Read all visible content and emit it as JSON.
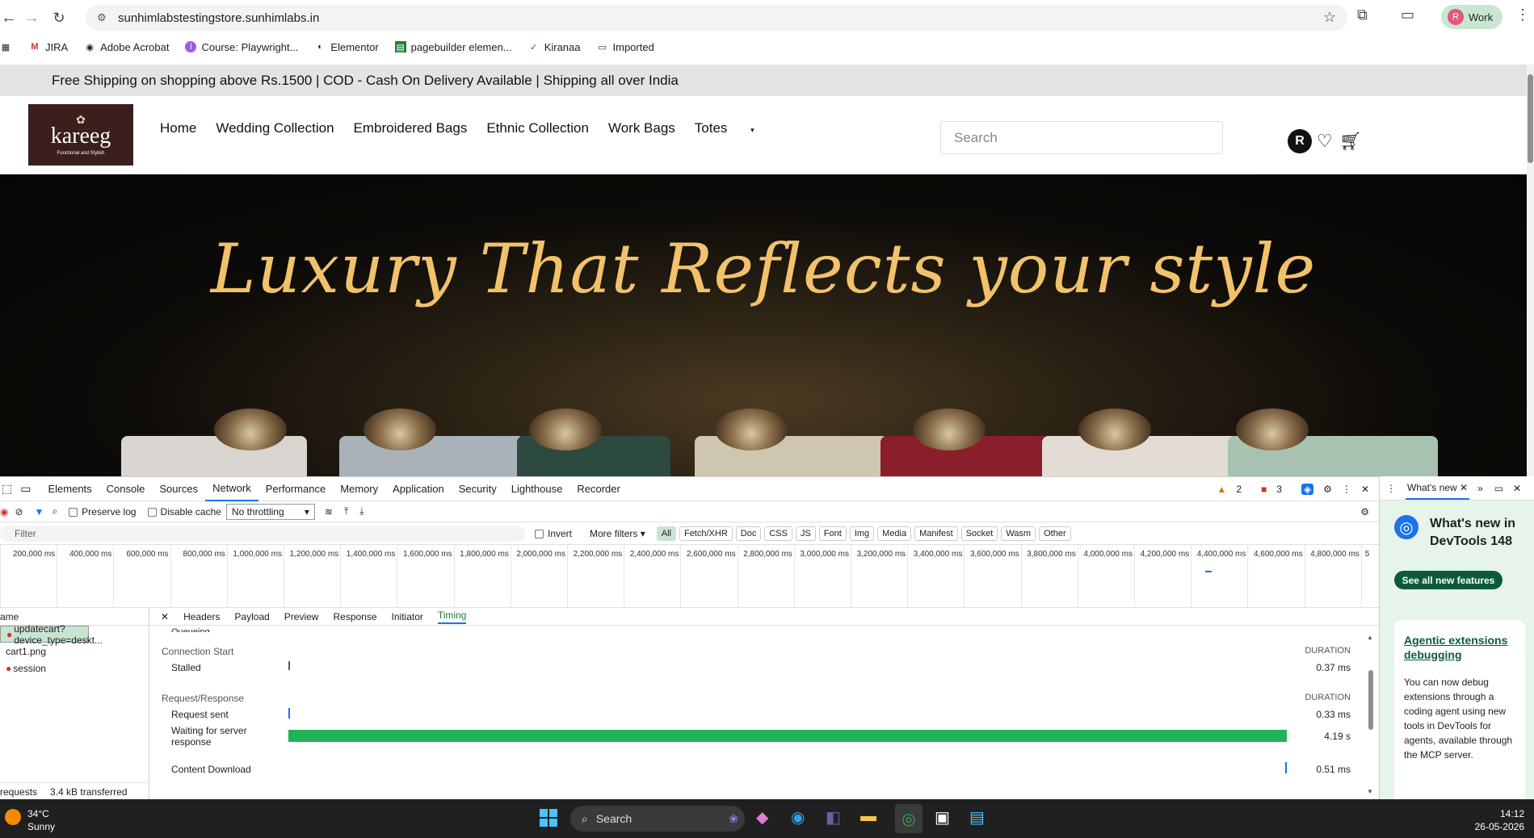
{
  "browser": {
    "url": "sunhimlabstestingstore.sunhimlabs.in",
    "profile_initial": "R",
    "profile_label": "Work",
    "bookmarks": [
      {
        "label": "",
        "icon": "apps-grid-icon"
      },
      {
        "label": "JIRA",
        "icon": "gmail-icon"
      },
      {
        "label": "Adobe Acrobat",
        "icon": "acrobat-icon"
      },
      {
        "label": "Course: Playwright...",
        "icon": "course-icon"
      },
      {
        "label": "Elementor",
        "icon": "globe-icon"
      },
      {
        "label": "pagebuilder elemen...",
        "icon": "sheets-icon"
      },
      {
        "label": "Kiranaa",
        "icon": "check-circle-icon"
      },
      {
        "label": "Imported",
        "icon": "folder-icon"
      }
    ]
  },
  "site": {
    "promo": "Free Shipping on shopping above Rs.1500 | COD - Cash On Delivery Available | Shipping all over India",
    "logo_text": "kareeg",
    "logo_tagline": "Functional and Stylish",
    "menu": [
      "Home",
      "Wedding Collection",
      "Embroidered Bags",
      "Ethnic Collection",
      "Work Bags",
      "Totes"
    ],
    "search_placeholder": "Search",
    "account_initial": "R",
    "hero_title": "Luxury That Reflects your style"
  },
  "devtools": {
    "tabs": [
      "Elements",
      "Console",
      "Sources",
      "Network",
      "Performance",
      "Memory",
      "Application",
      "Security",
      "Lighthouse",
      "Recorder"
    ],
    "active_tab": "Network",
    "warnings": "2",
    "errors": "3",
    "toolbar": {
      "preserve_log": "Preserve log",
      "disable_cache": "Disable cache",
      "throttling": "No throttling"
    },
    "filter_placeholder": "Filter",
    "invert": "Invert",
    "more_filters": "More filters",
    "type_filters": [
      "All",
      "Fetch/XHR",
      "Doc",
      "CSS",
      "JS",
      "Font",
      "Img",
      "Media",
      "Manifest",
      "Socket",
      "Wasm",
      "Other"
    ],
    "timeline_ticks": [
      "200,000 ms",
      "400,000 ms",
      "600,000 ms",
      "800,000 ms",
      "1,000,000 ms",
      "1,200,000 ms",
      "1,400,000 ms",
      "1,600,000 ms",
      "1,800,000 ms",
      "2,000,000 ms",
      "2,200,000 ms",
      "2,400,000 ms",
      "2,600,000 ms",
      "2,800,000 ms",
      "3,000,000 ms",
      "3,200,000 ms",
      "3,400,000 ms",
      "3,600,000 ms",
      "3,800,000 ms",
      "4,000,000 ms",
      "4,200,000 ms",
      "4,400,000 ms",
      "4,600,000 ms",
      "4,800,000 ms",
      "5"
    ],
    "name_header": "ame",
    "requests": [
      "updatecart?device_type=deskt...",
      "cart1.png",
      "session"
    ],
    "footer_requests": "requests",
    "footer_transferred": "3.4 kB transferred",
    "detail_tabs": [
      "Headers",
      "Payload",
      "Preview",
      "Response",
      "Initiator",
      "Timing"
    ],
    "active_detail_tab": "Timing",
    "timing": {
      "section1": "Connection Start",
      "section2": "Request/Response",
      "duration_label": "DURATION",
      "rows": [
        {
          "label": "Stalled",
          "value": "0.37 ms"
        },
        {
          "label": "Request sent",
          "value": "0.33 ms"
        },
        {
          "label": "Waiting for server response",
          "value": "4.19 s"
        },
        {
          "label": "Content Download",
          "value": "0.51 ms"
        }
      ],
      "queueing_label": "Queueing"
    }
  },
  "whats_new": {
    "tab": "What's new",
    "title": "What's new in DevTools 148",
    "button": "See all new features",
    "card_title": "Agentic extensions debugging",
    "card_body": "You can now debug extensions through a coding agent using new tools in DevTools for agents, available through the MCP server."
  },
  "taskbar": {
    "temp": "34°C",
    "weather": "Sunny",
    "search": "Search",
    "time": "14:12",
    "date": "26-05-2026"
  }
}
